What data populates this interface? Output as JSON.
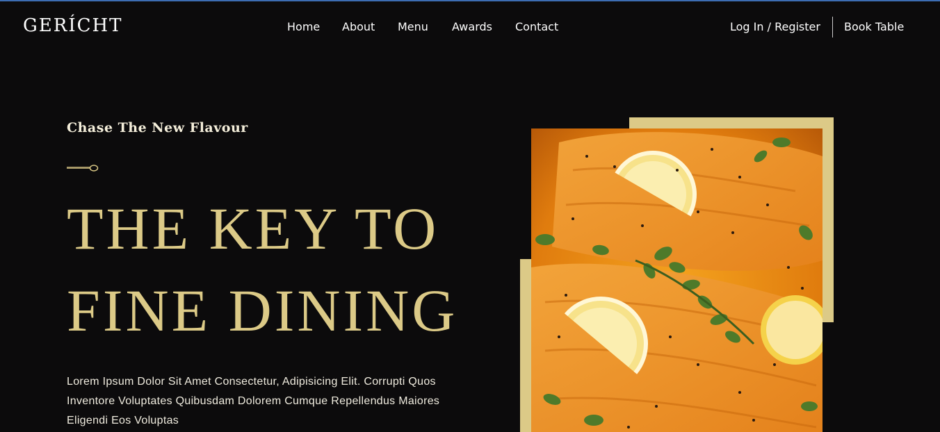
{
  "nav": {
    "logo": "GERÍCHT",
    "links": [
      "Home",
      "About",
      "Menu",
      "Awards",
      "Contact"
    ],
    "login": "Log In / Register",
    "book": "Book Table"
  },
  "hero": {
    "subtitle": "Chase The New Flavour",
    "headline_line1": "THE KEY TO",
    "headline_line2": "FINE DINING",
    "body": "Lorem Ipsum Dolor Sit Amet Consectetur, Adipisicing Elit. Corrupti Quos Inventore Voluptates Quibusdam Dolorem Cumque Repellendus Maiores Eligendi Eos Voluptas"
  },
  "image": {
    "subject": "salmon-with-lemon-and-herbs"
  },
  "colors": {
    "background": "#0c0b0c",
    "accent_gold": "#dcca87",
    "text_white": "#ffffff",
    "food_orange": "#e88a14"
  }
}
